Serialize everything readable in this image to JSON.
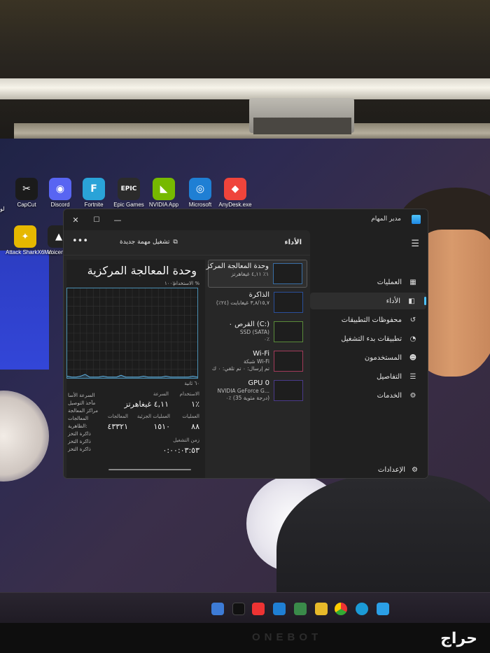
{
  "desktop": {
    "icons": [
      {
        "label": "CapCut",
        "glyph": "✂",
        "color": "#1b1b1b"
      },
      {
        "label": "Discord",
        "glyph": "◉",
        "color": "#5865f2"
      },
      {
        "label": "Fortnite",
        "glyph": "F",
        "color": "#2aa3d8"
      },
      {
        "label": "Epic Games",
        "glyph": "EPIC",
        "color": "#2b2b2b"
      },
      {
        "label": "NVIDIA App",
        "glyph": "◣",
        "color": "#76b900"
      },
      {
        "label": "Microsoft",
        "glyph": "◎",
        "color": "#1f7fd4"
      },
      {
        "label": "AnyDesk.exe",
        "glyph": "◆",
        "color": "#ef443b"
      }
    ],
    "icons_row2": [
      {
        "label": "Attack SharkX6Mo...",
        "glyph": "✦",
        "color": "#e6b800"
      },
      {
        "label": "Voicem...",
        "glyph": "▲",
        "color": "#222"
      }
    ],
    "edge_label": "لو"
  },
  "task_manager": {
    "title": "مدير المهام",
    "window_controls": {
      "close": "✕",
      "maximize": "☐",
      "minimize": "—"
    },
    "nav": [
      {
        "label": "العمليات",
        "icon": "grid-icon",
        "glyph": "▦"
      },
      {
        "label": "الأداء",
        "icon": "performance-icon",
        "glyph": "◧",
        "active": true
      },
      {
        "label": "محفوظات التطبيقات",
        "icon": "history-icon",
        "glyph": "↺"
      },
      {
        "label": "تطبيقات بدء التشغيل",
        "icon": "startup-icon",
        "glyph": "◔"
      },
      {
        "label": "المستخدمون",
        "icon": "users-icon",
        "glyph": "☻"
      },
      {
        "label": "التفاصيل",
        "icon": "list-icon",
        "glyph": "☰"
      },
      {
        "label": "الخدمات",
        "icon": "services-icon",
        "glyph": "⚙"
      }
    ],
    "settings_label": "الإعدادات",
    "toolbar": {
      "title": "الأداء",
      "run_task": "تشغيل مهمة جديدة",
      "more": "•••"
    },
    "resources": [
      {
        "name": "وحدة المعالجة المركز",
        "sub": "١٪ ٤,١١ غيغاهرتز",
        "selected": true
      },
      {
        "name": "الذاكرة",
        "sub": "٣,٨/١٥,٧ غيغابايت (٢٤٪)"
      },
      {
        "name": "القرص ٠ (C:)",
        "sub": "SSD (SATA)",
        "sub2": "٠٪"
      },
      {
        "name": "Wi-Fi",
        "sub": "شبكة Wi-Fi",
        "sub2": "تم إرسال: ٠ تم تلقي: ٠ ك"
      },
      {
        "name": "GPU 0",
        "sub": "NVIDIA GeForce G...",
        "sub2": "٠٪ (35 درجة مئوية)"
      }
    ],
    "detail": {
      "title": "وحدة المعالجة المركزية",
      "graph_caption": "الاستخدام %",
      "graph_max": "١٠٠٪",
      "graph_time": "٦٠ ثانية",
      "stats": {
        "usage_label": "الاستخدام",
        "usage_value": "١٪",
        "speed_label": "السرعة",
        "speed_value": "٤,١١ غيغاهرتز",
        "processes_label": "العمليات",
        "processes_value": "٨٨",
        "threads_label": "العمليات الجزئية",
        "threads_value": "١٥١٠",
        "handles_label": "المعالجات",
        "handles_value": "٤٣٣٢١",
        "uptime_label": "زمن التشغيل",
        "uptime_value": "٠:٠٠:٠٣:٥٣"
      },
      "side_labels": [
        "السرعة الأسا",
        "مآخذ التوصيل",
        "مراكز المعالجة",
        "المعالجات",
        "الظاهرية:",
        "ذاكرة التخز",
        "ذاكرة التخز",
        "ذاكرة التخز"
      ]
    },
    "cpu_history": [
      2,
      1,
      1,
      2,
      4,
      1,
      1,
      1,
      2,
      1,
      1,
      1,
      3,
      1,
      1,
      1,
      1,
      2,
      1,
      1,
      1,
      1,
      2,
      1,
      1,
      1,
      1,
      1,
      2,
      1
    ]
  },
  "watermark": "حراج",
  "monitor_brand": "ONEBOT"
}
